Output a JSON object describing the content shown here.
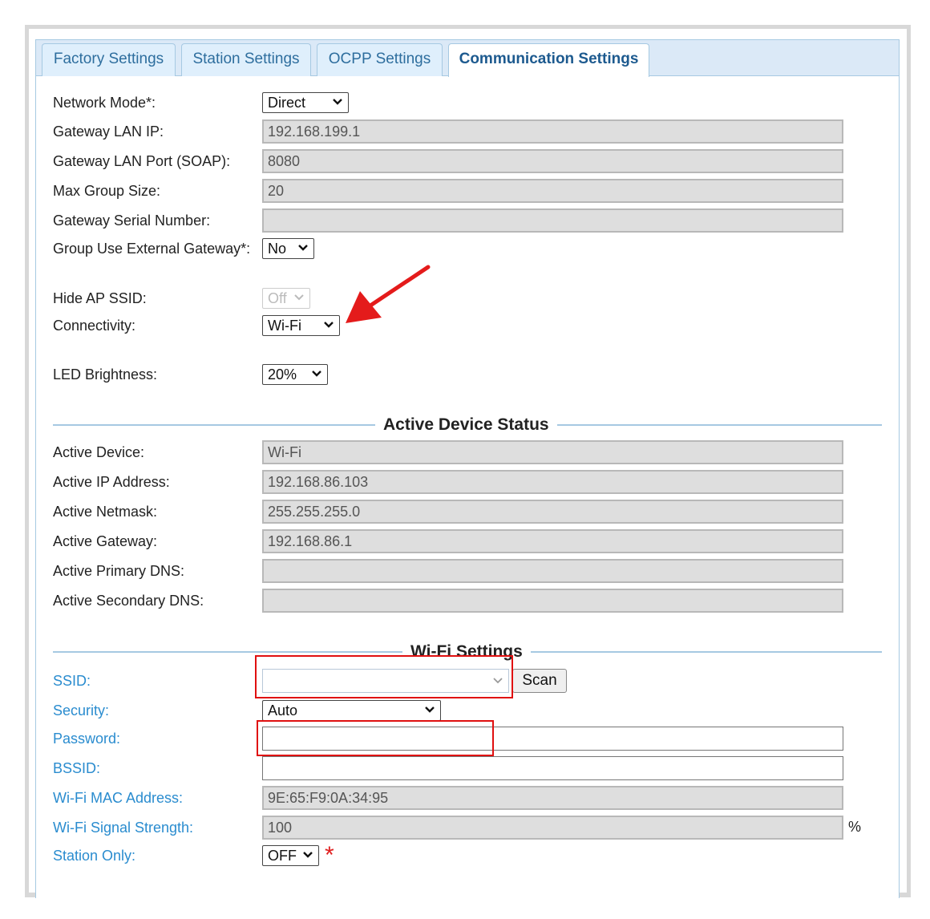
{
  "tabs": [
    {
      "label": "Factory Settings"
    },
    {
      "label": "Station Settings"
    },
    {
      "label": "OCPP Settings"
    },
    {
      "label": "Communication Settings"
    }
  ],
  "form": {
    "network_mode": {
      "label": "Network Mode*:",
      "value": "Direct"
    },
    "gateway_lan_ip": {
      "label": "Gateway LAN IP:",
      "value": "192.168.199.1"
    },
    "gateway_lan_port": {
      "label": "Gateway LAN Port (SOAP):",
      "value": "8080"
    },
    "max_group_size": {
      "label": "Max Group Size:",
      "value": "20"
    },
    "gateway_serial": {
      "label": "Gateway Serial Number:",
      "value": ""
    },
    "group_external_gateway": {
      "label": "Group Use External Gateway*:",
      "value": "No"
    },
    "hide_ap_ssid": {
      "label": "Hide AP SSID:",
      "value": "Off"
    },
    "connectivity": {
      "label": "Connectivity:",
      "value": "Wi-Fi"
    },
    "led_brightness": {
      "label": "LED Brightness:",
      "value": "20%"
    }
  },
  "active_status": {
    "title": "Active Device Status",
    "active_device": {
      "label": "Active Device:",
      "value": "Wi-Fi"
    },
    "active_ip": {
      "label": "Active IP Address:",
      "value": "192.168.86.103"
    },
    "active_netmask": {
      "label": "Active Netmask:",
      "value": "255.255.255.0"
    },
    "active_gateway": {
      "label": "Active Gateway:",
      "value": "192.168.86.1"
    },
    "primary_dns": {
      "label": "Active Primary DNS:",
      "value": ""
    },
    "secondary_dns": {
      "label": "Active Secondary DNS:",
      "value": ""
    }
  },
  "wifi": {
    "title": "Wi-Fi Settings",
    "ssid": {
      "label": "SSID:",
      "value": ""
    },
    "scan_label": "Scan",
    "security": {
      "label": "Security:",
      "value": "Auto"
    },
    "password": {
      "label": "Password:",
      "value": ""
    },
    "bssid": {
      "label": "BSSID:",
      "value": ""
    },
    "mac": {
      "label": "Wi-Fi MAC Address:",
      "value": "9E:65:F9:0A:34:95"
    },
    "signal": {
      "label": "Wi-Fi Signal Strength:",
      "value": "100",
      "unit": "%"
    },
    "station_only": {
      "label": "Station Only:",
      "value": "OFF"
    },
    "required_mark": "*"
  },
  "colors": {
    "tab_border": "#a6c9e2",
    "label_blue": "#2a8ccf",
    "highlight_red": "#e01010"
  }
}
